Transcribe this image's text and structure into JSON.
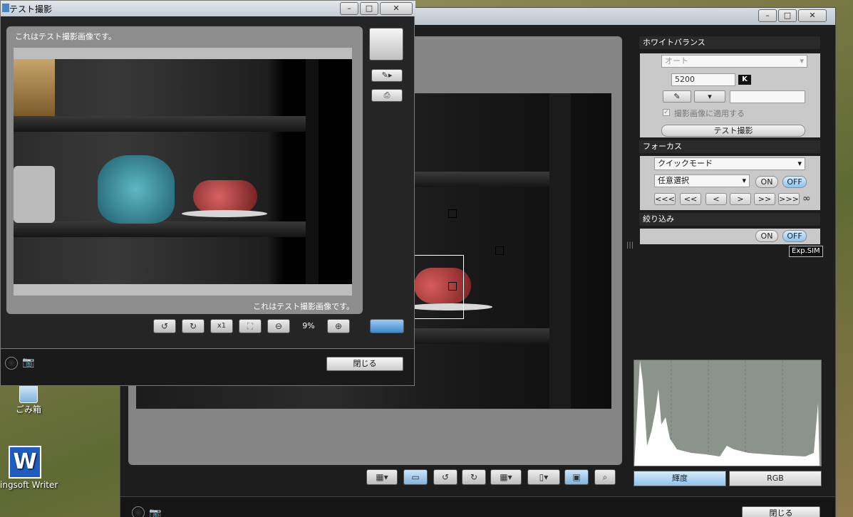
{
  "desktop": {
    "icons": [
      {
        "label": "ごみ箱"
      },
      {
        "label": "ingsoft Writer"
      }
    ]
  },
  "main_window": {
    "right_panel": {
      "white_balance": {
        "header": "ホワイトバランス",
        "mode": "オート",
        "kelvin_value": "5200",
        "kelvin_unit": "K",
        "apply_checkbox_label": "撮影画像に適用する",
        "apply_checked": true,
        "test_shot_button": "テスト撮影"
      },
      "focus": {
        "header": "フォーカス",
        "af_mode": "クイックモード",
        "af_point_select": "任意選択",
        "on_label": "ON",
        "off_label": "OFF",
        "nav_buttons": [
          "<<<",
          "<<",
          "<",
          ">",
          ">>",
          ">>>"
        ],
        "infinity": "∞"
      },
      "aperture": {
        "header": "絞り込み",
        "on_label": "ON",
        "off_label": "OFF"
      },
      "exp_sim": "Exp.SIM",
      "histogram_tabs": [
        "輝度",
        "RGB"
      ],
      "active_histogram_tab": "輝度"
    },
    "close_button": "閉じる"
  },
  "test_window": {
    "title": "テスト撮影",
    "caption_top": "これはテスト撮影画像です。",
    "caption_bottom": "これはテスト撮影画像です。",
    "zoom_level": "9%",
    "x1_label": "x1",
    "close_button": "閉じる"
  },
  "colors": {
    "panel_dark": "#1d1d1d",
    "accent_blue": "#8ec2ec",
    "histogram_bg": "#8b948a"
  }
}
